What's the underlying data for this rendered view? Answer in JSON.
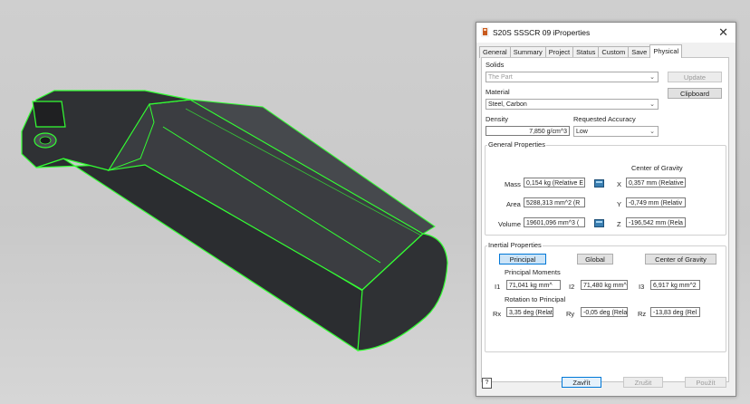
{
  "dialog": {
    "title": "S20S SSSCR 09 iProperties",
    "close_glyph": "✕",
    "tabs": [
      "General",
      "Summary",
      "Project",
      "Status",
      "Custom",
      "Save",
      "Physical"
    ],
    "active_tab": "Physical"
  },
  "physical": {
    "solids_label": "Solids",
    "solids_value": "The Part",
    "update_label": "Update",
    "clipboard_label": "Clipboard",
    "material_label": "Material",
    "material_value": "Steel, Carbon",
    "density_label": "Density",
    "density_value": "7,850 g/cm^3",
    "accuracy_label": "Requested Accuracy",
    "accuracy_value": "Low",
    "general_props_label": "General Properties",
    "cog_label": "Center of Gravity",
    "mass_label": "Mass",
    "mass_value": "0,154 kg (Relative E",
    "area_label": "Area",
    "area_value": "5288,313 mm^2 (R",
    "volume_label": "Volume",
    "volume_value": "19601,096 mm^3 (",
    "x_label": "X",
    "x_value": "0,357 mm (Relative",
    "y_label": "Y",
    "y_value": "-0,749 mm (Relativ",
    "z_label": "Z",
    "z_value": "-196,542 mm (Rela",
    "inertial_label": "Inertial Properties",
    "principal_btn": "Principal",
    "global_btn": "Global",
    "cog_btn": "Center of Gravity",
    "principal_moments_label": "Principal Moments",
    "i1_label": "I1",
    "i1_value": "71,041 kg mm^",
    "i2_label": "I2",
    "i2_value": "71,480 kg mm^",
    "i3_label": "I3",
    "i3_value": "6,917 kg mm^2",
    "rotation_label": "Rotation to Principal",
    "rx_label": "Rx",
    "rx_value": "3,35 deg (Relat",
    "ry_label": "Ry",
    "ry_value": "-0,05 deg (Rela",
    "rz_label": "Rz",
    "rz_value": "-13,83 deg (Rel"
  },
  "footer": {
    "help_glyph": "?",
    "close_label": "Zavřít",
    "cancel_label": "Zrušit",
    "apply_label": "Použít"
  }
}
